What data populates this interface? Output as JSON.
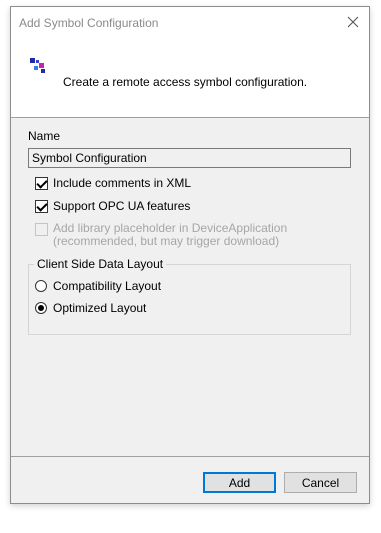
{
  "window": {
    "title": "Add Symbol Configuration",
    "close_icon": "close-icon"
  },
  "header": {
    "icon": "symbol-configuration-icon",
    "text": "Create a remote access symbol configuration."
  },
  "form": {
    "name_label": "Name",
    "name_value": "Symbol Configuration",
    "options": [
      {
        "label": "Include comments in XML",
        "checked": true,
        "enabled": true
      },
      {
        "label": "Support OPC UA features",
        "checked": true,
        "enabled": true
      },
      {
        "label": "Add library placeholder in DeviceApplication",
        "label2": "(recommended, but may trigger download)",
        "checked": false,
        "enabled": false
      }
    ]
  },
  "layout_group": {
    "legend": "Client Side Data Layout",
    "options": [
      {
        "label": "Compatibility Layout",
        "selected": false
      },
      {
        "label": "Optimized Layout",
        "selected": true
      }
    ]
  },
  "buttons": {
    "add": "Add",
    "cancel": "Cancel"
  }
}
